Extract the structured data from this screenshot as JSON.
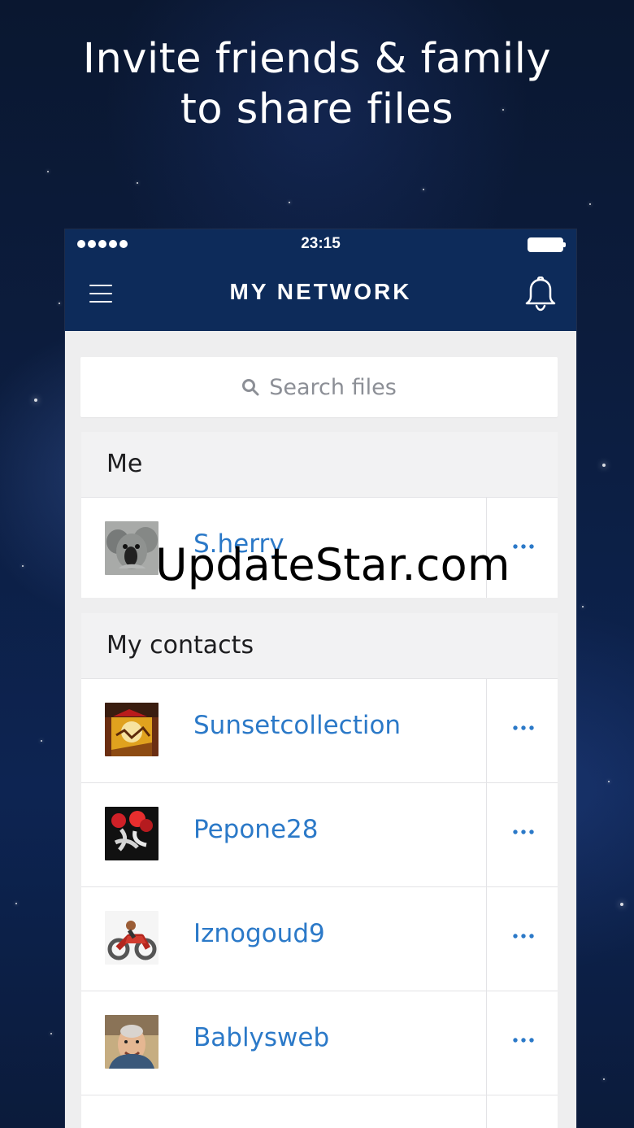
{
  "headline": {
    "line1": "Invite friends & family",
    "line2": "to share files"
  },
  "status_bar": {
    "time": "23:15",
    "signal_icon": "signal-icon",
    "battery_icon": "battery-icon"
  },
  "navbar": {
    "menu_icon": "menu-icon",
    "title": "MY NETWORK",
    "bell_icon": "bell-icon"
  },
  "search": {
    "placeholder": "Search files",
    "icon": "search-icon"
  },
  "sections": {
    "me": {
      "title": "Me",
      "items": [
        {
          "name": "S.herry",
          "avatar_icon": "koala-avatar"
        }
      ]
    },
    "contacts": {
      "title": "My contacts",
      "items": [
        {
          "name": "Sunsetcollection",
          "avatar_icon": "sunset-avatar"
        },
        {
          "name": "Pepone28",
          "avatar_icon": "rose-avatar"
        },
        {
          "name": "Iznogoud9",
          "avatar_icon": "motorbike-avatar"
        },
        {
          "name": "Bablysweb",
          "avatar_icon": "face-avatar"
        }
      ]
    }
  },
  "watermark": "UpdateStar.com",
  "colors": {
    "nav_blue": "#0d2b5a",
    "link_blue": "#2b79c8",
    "background": "#eeeeef"
  }
}
